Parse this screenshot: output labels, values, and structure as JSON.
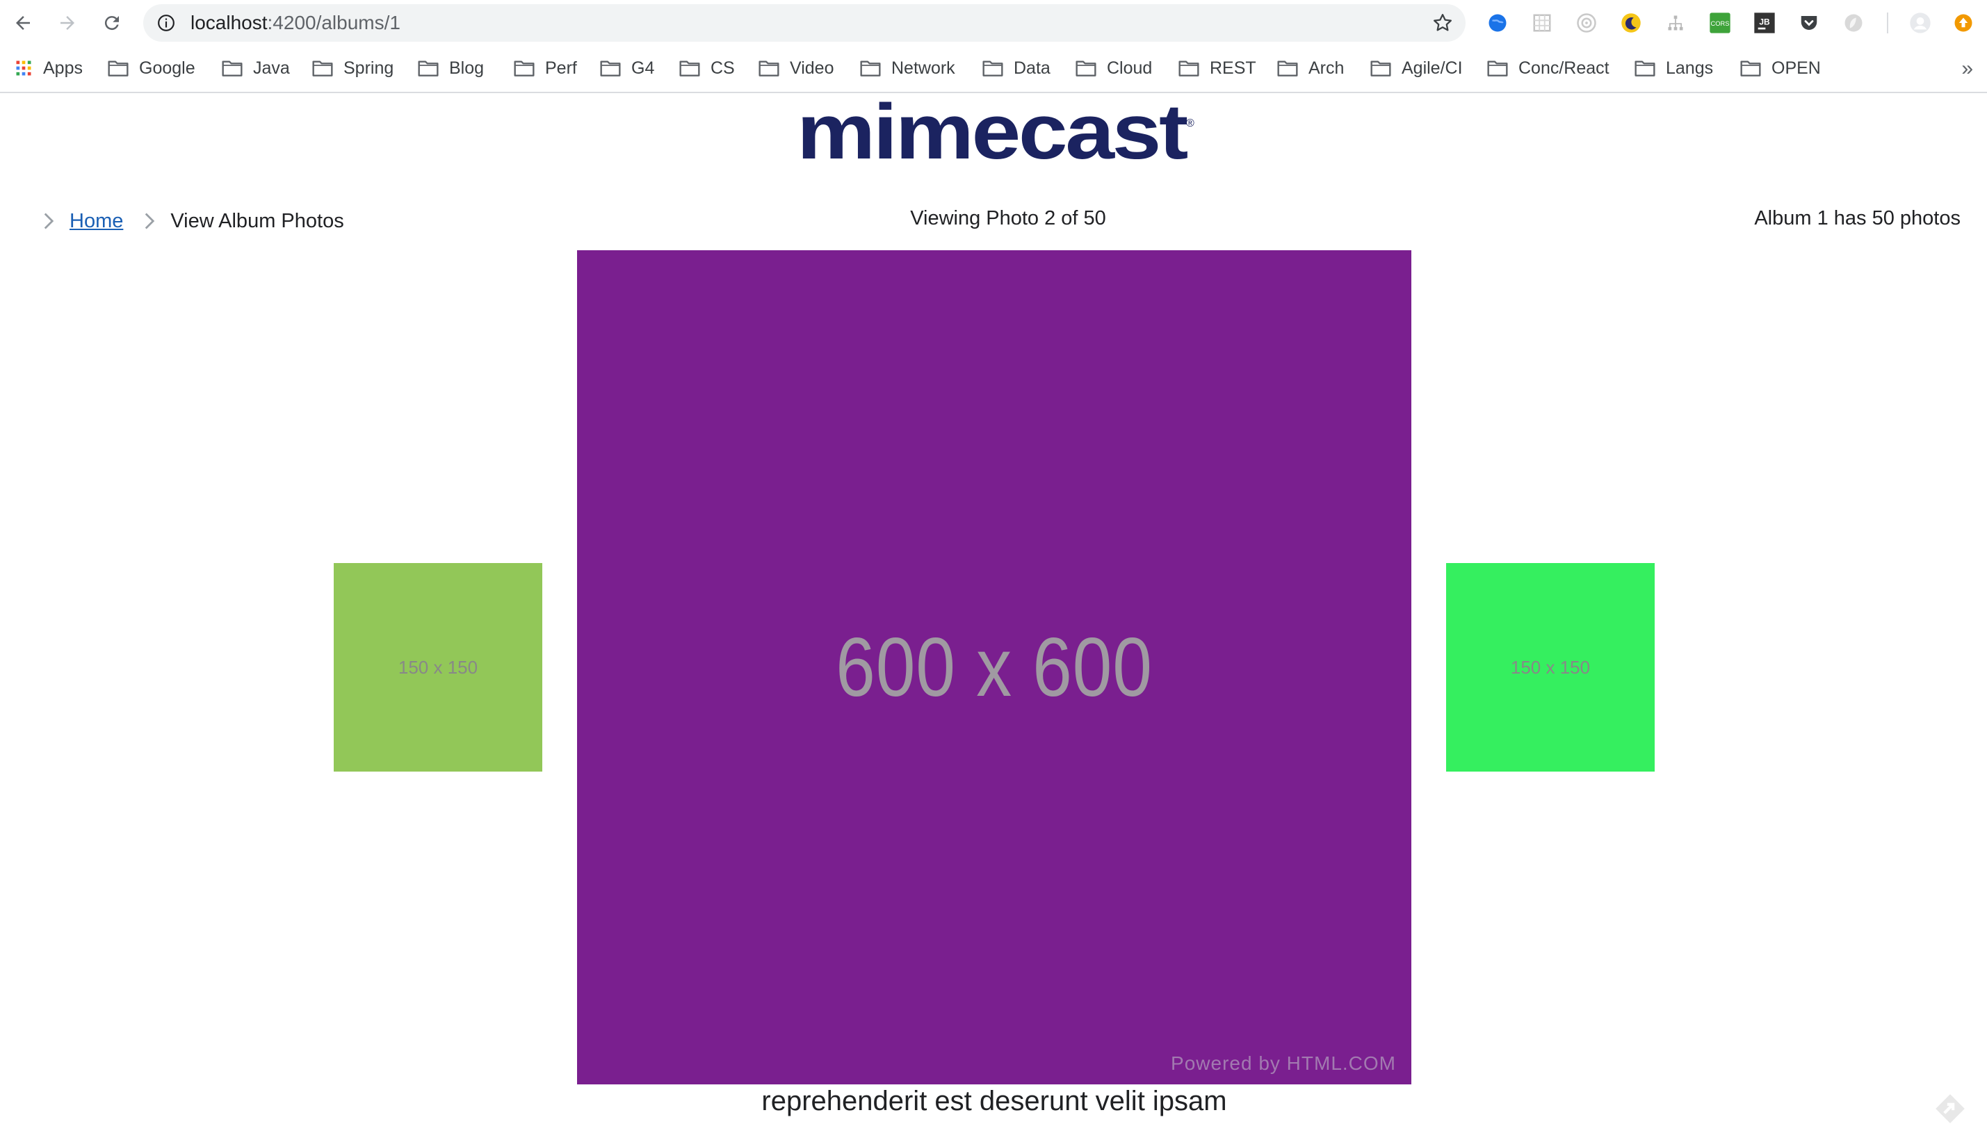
{
  "browser": {
    "url_host": "localhost",
    "url_path": ":4200/albums/1",
    "bookmarks": [
      "Apps",
      "Google",
      "Java",
      "Spring",
      "Blog",
      "Perf",
      "G4",
      "CS",
      "Video",
      "Network",
      "Data",
      "Cloud",
      "REST",
      "Arch",
      "Agile/CI",
      "Conc/React",
      "Langs",
      "OPEN"
    ],
    "more": "»",
    "extensions": [
      "globe-icon",
      "grid-icon",
      "target-icon",
      "moon-icon",
      "sitemap-icon",
      "cors-icon",
      "jb-icon",
      "pocket-icon",
      "feather-icon",
      "profile-icon",
      "update-icon"
    ]
  },
  "page": {
    "logo_text": "mimecast",
    "logo_mark": "®",
    "breadcrumb": {
      "home": "Home",
      "current": "View Album Photos"
    },
    "viewing": "Viewing Photo 2 of 50",
    "album_info": "Album 1 has 50 photos",
    "prev_thumb": {
      "label": "150 x 150",
      "color": "#92c758"
    },
    "main_photo": {
      "label": "600 x 600",
      "powered": "Powered by HTML.COM",
      "color": "#7a1f8f"
    },
    "next_thumb": {
      "label": "150 x 150",
      "color": "#35ef5f"
    },
    "caption": "reprehenderit est deserunt velit ipsam"
  },
  "colors": {
    "logo": "#1b2360",
    "link": "#1a5fb4"
  }
}
